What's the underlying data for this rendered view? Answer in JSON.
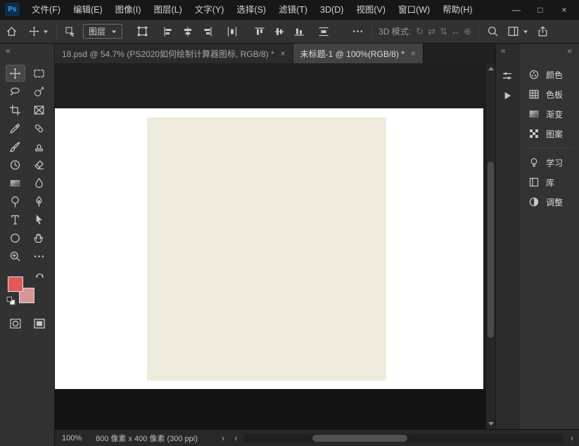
{
  "app": {
    "logo": "Ps"
  },
  "menubar": {
    "items": [
      "文件(F)",
      "编辑(E)",
      "图像(I)",
      "图层(L)",
      "文字(Y)",
      "选择(S)",
      "滤镜(T)",
      "3D(D)",
      "视图(V)",
      "窗口(W)",
      "帮助(H)"
    ]
  },
  "window_controls": {
    "minimize": "—",
    "maximize": "□",
    "close": "×"
  },
  "options_bar": {
    "auto_select_value": "图层",
    "mode_label": "3D 模式:",
    "mode_icons": [
      "↻",
      "⇄",
      "⇅",
      "↔",
      "⊕"
    ]
  },
  "tabs": [
    {
      "label": "18.psd @ 54.7% (PS2020如何绘制计算器图标, RGB/8) *",
      "close": "×",
      "active": false
    },
    {
      "label": "未标题-1 @ 100%(RGB/8) *",
      "close": "×",
      "active": true
    }
  ],
  "toolbar": {
    "collapse": "«",
    "tools": [
      "move",
      "rectangular-marquee",
      "lasso",
      "quick-selection",
      "crop",
      "frame",
      "eyedropper",
      "spot-healing-brush",
      "brush",
      "clone-stamp",
      "history-brush",
      "eraser",
      "gradient",
      "blur",
      "dodge",
      "pen",
      "horizontal-type",
      "path-selection",
      "ellipse-shape",
      "hand",
      "zoom",
      "edit-toolbar"
    ],
    "selected_tool": "move"
  },
  "panels": {
    "strip_collapse": "«",
    "collapse": "«",
    "items": [
      {
        "label": "颜色"
      },
      {
        "label": "色板"
      },
      {
        "label": "渐变"
      },
      {
        "label": "图案"
      },
      {
        "label": "学习"
      },
      {
        "label": "库"
      },
      {
        "label": "调整"
      }
    ]
  },
  "statusbar": {
    "zoom": "100%",
    "doc_info": "800 像素 x 400 像素 (300 ppi)",
    "expander": "›",
    "scroll_left": "‹",
    "scroll_right": "›"
  },
  "colors": {
    "foreground": "#e05a5a",
    "background": "#d89595",
    "document": "#ffffff",
    "shape": "#eeebdd"
  }
}
